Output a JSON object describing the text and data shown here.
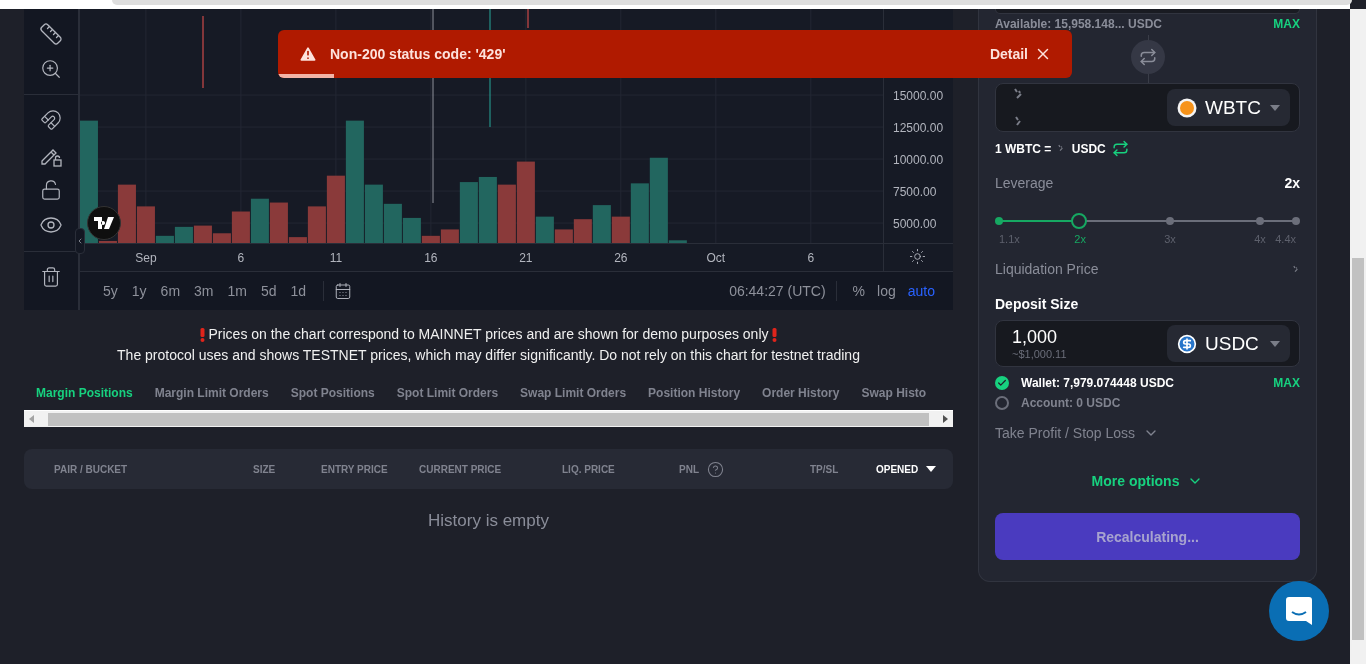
{
  "toast": {
    "message": "Non-200 status code: '429'",
    "action": "Detail",
    "level": 0.07
  },
  "chart": {
    "chart_data": {
      "type": "bar",
      "categories": [
        null,
        null,
        null,
        "Sep",
        null,
        null,
        null,
        null,
        "6",
        null,
        null,
        null,
        null,
        "11",
        null,
        null,
        null,
        null,
        "16",
        null,
        null,
        null,
        null,
        "21",
        null,
        null,
        null,
        null,
        "26",
        null,
        null,
        null,
        null,
        "Oct",
        null,
        null,
        null,
        null,
        "6",
        null,
        null,
        null
      ],
      "series": [
        {
          "color": "#22665f",
          "values": [
            13000,
            null,
            null,
            null,
            4000,
            4700,
            null,
            null,
            null,
            6900,
            null,
            null,
            null,
            null,
            13000,
            8000,
            6500,
            5400,
            null,
            null,
            8200,
            8600,
            null,
            null,
            5500,
            null,
            null,
            6400,
            null,
            8100,
            10100,
            3650,
            null,
            null,
            null,
            null,
            null,
            null,
            null,
            null,
            null,
            null
          ]
        },
        {
          "color": "#8a3a3a",
          "values": [
            null,
            3600,
            8000,
            6300,
            null,
            null,
            4800,
            4200,
            5900,
            null,
            6600,
            3900,
            6300,
            8700,
            null,
            null,
            null,
            null,
            4000,
            4500,
            null,
            null,
            8000,
            9800,
            null,
            4500,
            5300,
            null,
            5500,
            null,
            null,
            null,
            null,
            null,
            null,
            null,
            null,
            null,
            null,
            null,
            null,
            null
          ]
        }
      ],
      "ylim": [
        3440,
        21800
      ],
      "yticks": [
        {
          "value": 5000,
          "label": "5000.00"
        },
        {
          "value": 7500,
          "label": "7500.00"
        },
        {
          "value": 10000,
          "label": "10000.00"
        },
        {
          "value": 12500,
          "label": "12500.00"
        },
        {
          "value": 15000,
          "label": "15000.00"
        }
      ],
      "grid": true
    },
    "time_ranges": [
      "5y",
      "1y",
      "6m",
      "3m",
      "1m",
      "5d",
      "1d"
    ],
    "clock": "06:44:27 (UTC)",
    "scale_options": [
      {
        "label": "%",
        "selected": false
      },
      {
        "label": "log",
        "selected": false
      },
      {
        "label": "auto",
        "selected": true
      }
    ]
  },
  "notice": [
    "Prices on the chart correspond to MAINNET prices and are shown for demo purposes only",
    "The protocol uses and shows TESTNET prices, which may differ significantly. Do not rely on this chart for testnet trading"
  ],
  "tabs": [
    {
      "label": "Margin Positions",
      "selected": true
    },
    {
      "label": "Margin Limit Orders",
      "selected": false
    },
    {
      "label": "Spot Positions",
      "selected": false
    },
    {
      "label": "Spot Limit Orders",
      "selected": false
    },
    {
      "label": "Swap Limit Orders",
      "selected": false
    },
    {
      "label": "Position History",
      "selected": false
    },
    {
      "label": "Order History",
      "selected": false
    },
    {
      "label": "Swap Histo",
      "selected": false
    }
  ],
  "table": {
    "columns": [
      {
        "label": "PAIR / BUCKET",
        "kind": "text"
      },
      {
        "label": "SIZE",
        "kind": "text"
      },
      {
        "label": "ENTRY PRICE",
        "kind": "text"
      },
      {
        "label": "CURRENT PRICE",
        "kind": "text"
      },
      {
        "label": "LIQ. PRICE",
        "kind": "text"
      },
      {
        "label": "PNL",
        "kind": "help"
      },
      {
        "label": "TP/SL",
        "kind": "text"
      },
      {
        "label": "OPENED",
        "kind": "dropdown"
      }
    ],
    "empty_text": "History is empty"
  },
  "order_form": {
    "available": "Available: 15,958.148... USDC",
    "max_label": "MAX",
    "buy_token": "WBTC",
    "rate": {
      "prefix": "1 WBTC =",
      "suffix": "USDC"
    },
    "leverage": {
      "label": "Leverage",
      "value": "2x",
      "level": 0.27,
      "stops": [
        {
          "label": "1.1x",
          "selected": false
        },
        {
          "label": "2x",
          "selected": true
        },
        {
          "label": "3x",
          "selected": false
        },
        {
          "label": "4x",
          "selected": false
        },
        {
          "label": "4.4x",
          "selected": false
        }
      ]
    },
    "liquidation_label": "Liquidation Price",
    "deposit": {
      "label": "Deposit Size",
      "value": "1,000",
      "usd": "~$1,000.11",
      "token": "USDC"
    },
    "sources": [
      {
        "label": "Wallet: 7,979.074448 USDC",
        "selected": true
      },
      {
        "label": "Account: 0 USDC",
        "selected": false
      }
    ],
    "source_max": "MAX",
    "tp_sl": "Take Profit / Stop Loss",
    "more_options": "More options",
    "submit": {
      "label": "Recalculating...",
      "disabled": true
    }
  }
}
